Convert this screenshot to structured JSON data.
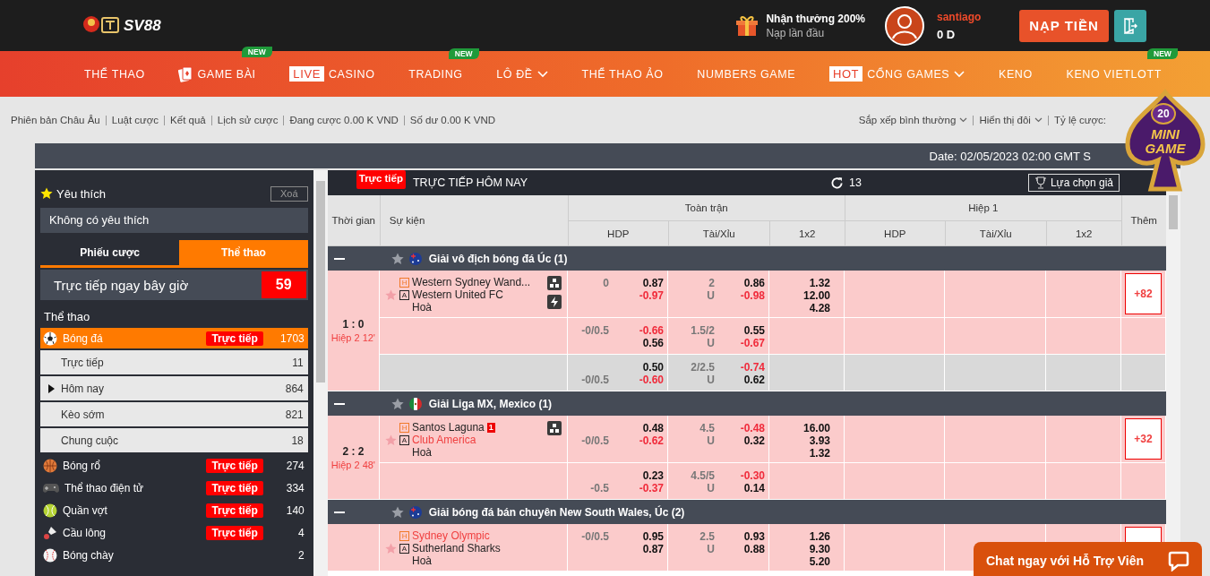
{
  "logo": {
    "text": "SV88"
  },
  "header": {
    "promo": {
      "title": "Nhận thưởng 200%",
      "subtitle": "Nạp lần đầu"
    },
    "user": {
      "name": "santiago",
      "balance": "0 D"
    },
    "deposit_button": "NẠP TIỀN"
  },
  "nav": [
    {
      "label": "THỂ THAO",
      "dropdown": false
    },
    {
      "label": "GAME BÀI",
      "kind": "cards",
      "badge": "NEW",
      "dropdown": false
    },
    {
      "tag": "LIVE",
      "label": "CASINO",
      "dropdown": false
    },
    {
      "label": "TRADING",
      "badge": "NEW",
      "dropdown": false
    },
    {
      "label": "LÔ ĐỀ",
      "dropdown": true
    },
    {
      "label": "THỂ THAO ẢO",
      "dropdown": false
    },
    {
      "label": "NUMBERS GAME",
      "dropdown": false
    },
    {
      "tag": "HOT",
      "label": "CỔNG GAMES",
      "dropdown": true
    },
    {
      "label": "KENO",
      "dropdown": false
    },
    {
      "label": "KENO VIETLOTT",
      "badge": "NEW",
      "dropdown": false
    }
  ],
  "sub_links": [
    "Phiên bản Châu Âu",
    "Luật cược",
    "Kết quả",
    "Lịch sử cược",
    "Đang cược 0.00 K VND",
    "Số dư 0.00 K VND"
  ],
  "view_menus": [
    {
      "label": "Sắp xếp bình thường",
      "dropdown": true
    },
    {
      "label": "Hiển thị đôi",
      "dropdown": true
    },
    {
      "label": "Tỷ lệ cược:",
      "dropdown": false
    }
  ],
  "date": "Date: 02/05/2023 02:00 GMT S",
  "mini_game": {
    "count": "20",
    "line_1": "MINI",
    "line_2": "GAME"
  },
  "sidebar": {
    "favorites": {
      "title": "Yêu thích",
      "clear": "Xoá",
      "empty": "Không có yêu thích"
    },
    "tabs": [
      {
        "label": "Phiếu cược",
        "selected": false
      },
      {
        "label": "Thể thao",
        "selected": true
      }
    ],
    "live_now": {
      "label": "Trực tiếp ngay bây giờ",
      "count": "59"
    },
    "sports_title": "Thể thao",
    "sports": [
      {
        "kind": "soccer",
        "name": "Bóng đá",
        "live": "Trực tiếp",
        "count": "1703",
        "selected": true,
        "children": [
          {
            "name": "Trực tiếp",
            "count": "11",
            "selected": false
          },
          {
            "name": "Hôm nay",
            "count": "864",
            "selected": true
          },
          {
            "name": "Kèo sớm",
            "count": "821",
            "selected": false
          },
          {
            "name": "Chung cuộc",
            "count": "18",
            "selected": false
          }
        ]
      },
      {
        "kind": "basketball",
        "name": "Bóng rổ",
        "live": "Trực tiếp",
        "count": "274",
        "selected": false
      },
      {
        "kind": "esports",
        "name": "Thể thao điện tử",
        "live": "Trực tiếp",
        "count": "334",
        "selected": false
      },
      {
        "kind": "tennis",
        "name": "Quần vợt",
        "live": "Trực tiếp",
        "count": "140",
        "selected": false
      },
      {
        "kind": "badminton",
        "name": "Cầu lông",
        "live": "Trực tiếp",
        "count": "4",
        "selected": false
      },
      {
        "kind": "baseball",
        "name": "Bóng chày",
        "count": "2",
        "selected": false
      }
    ]
  },
  "board": {
    "live_badge": "Trực tiếp",
    "title": "TRỰC TIẾP HÔM NAY",
    "refresh_count": "13",
    "league_filter": "Lựa chọn giả",
    "columns": {
      "time": "Thời gian",
      "event": "Sự kiện",
      "full_time": "Toàn trận",
      "first_half": "Hiệp 1",
      "more": "Thêm",
      "sub": [
        "HDP",
        "Tài/Xỉu",
        "1x2",
        "HDP",
        "Tài/Xỉu",
        "1x2"
      ]
    },
    "leagues": [
      {
        "name": "Giải vô địch bóng đá Úc (1)",
        "kind": "australia",
        "expanded": true,
        "favorite": false,
        "matches": [
          {
            "score": "1 : 0",
            "period": "Hiệp 2 12'",
            "favorite": false,
            "home": {
              "mark": "H",
              "name": "Western Sydney Wand...",
              "highlight": false
            },
            "away": {
              "mark": "A",
              "name": "Western United FC",
              "highlight": false
            },
            "draw": "Hoà",
            "tools": [
              {
                "kind": "stats"
              },
              {
                "kind": "flash"
              }
            ],
            "more": "+82",
            "lines": [
              {
                "alternate": false,
                "hdp": {
                  "home_line": "0",
                  "odds": [
                    {
                      "value": "0.87",
                      "negative": false
                    },
                    {
                      "value": "-0.97",
                      "negative": true
                    }
                  ]
                },
                "ou": {
                  "line": "2",
                  "under": "U",
                  "odds": [
                    {
                      "value": "0.86",
                      "negative": false
                    },
                    {
                      "value": "-0.98",
                      "negative": true
                    }
                  ]
                },
                "x12": [
                  "1.32",
                  "12.00",
                  "4.28"
                ]
              },
              {
                "alternate": false,
                "hdp": {
                  "home_line": "-0/0.5",
                  "odds": [
                    {
                      "value": "-0.66",
                      "negative": true
                    },
                    {
                      "value": "0.56",
                      "negative": false
                    }
                  ]
                },
                "ou": {
                  "line": "1.5/2",
                  "under": "U",
                  "odds": [
                    {
                      "value": "0.55",
                      "negative": false
                    },
                    {
                      "value": "-0.67",
                      "negative": true
                    }
                  ]
                }
              },
              {
                "alternate": true,
                "hdp": {
                  "away_line": "-0/0.5",
                  "odds": [
                    {
                      "value": "0.50",
                      "negative": false
                    },
                    {
                      "value": "-0.60",
                      "negative": true
                    }
                  ]
                },
                "ou": {
                  "line": "2/2.5",
                  "under": "U",
                  "odds": [
                    {
                      "value": "-0.74",
                      "negative": true
                    },
                    {
                      "value": "0.62",
                      "negative": false
                    }
                  ]
                }
              }
            ]
          }
        ]
      },
      {
        "name": "Giải Liga MX, Mexico (1)",
        "kind": "mexico",
        "expanded": true,
        "favorite": false,
        "matches": [
          {
            "score": "2 : 2",
            "period": "Hiệp 2 48'",
            "favorite": false,
            "home": {
              "mark": "H",
              "name": "Santos Laguna",
              "highlight": false,
              "red_cards": "1"
            },
            "away": {
              "mark": "A",
              "name": "Club America",
              "highlight": true
            },
            "draw": "Hoà",
            "tools": [
              {
                "kind": "stats"
              }
            ],
            "more": "+32",
            "lines": [
              {
                "alternate": false,
                "hdp": {
                  "away_line": "-0/0.5",
                  "odds": [
                    {
                      "value": "0.48",
                      "negative": false
                    },
                    {
                      "value": "-0.62",
                      "negative": true
                    }
                  ]
                },
                "ou": {
                  "line": "4.5",
                  "under": "U",
                  "odds": [
                    {
                      "value": "-0.48",
                      "negative": true
                    },
                    {
                      "value": "0.32",
                      "negative": false
                    }
                  ]
                },
                "x12": [
                  "16.00",
                  "3.93",
                  "1.32"
                ]
              },
              {
                "alternate": false,
                "hdp": {
                  "away_line": "-0.5",
                  "odds": [
                    {
                      "value": "0.23",
                      "negative": false
                    },
                    {
                      "value": "-0.37",
                      "negative": true
                    }
                  ]
                },
                "ou": {
                  "line": "4.5/5",
                  "under": "U",
                  "odds": [
                    {
                      "value": "-0.30",
                      "negative": true
                    },
                    {
                      "value": "0.14",
                      "negative": false
                    }
                  ]
                }
              }
            ]
          }
        ]
      },
      {
        "name": "Giải bóng đá bán chuyên New South Wales, Úc (2)",
        "kind": "australia",
        "expanded": true,
        "favorite": false,
        "matches": [
          {
            "favorite": false,
            "home": {
              "mark": "H",
              "name": "Sydney Olympic",
              "highlight": true
            },
            "away": {
              "mark": "A",
              "name": "Sutherland Sharks",
              "highlight": false
            },
            "draw": "Hoà",
            "lines": [
              {
                "alternate": false,
                "hdp": {
                  "home_line": "-0/0.5",
                  "odds": [
                    {
                      "value": "0.95",
                      "negative": false
                    },
                    {
                      "value": "0.87",
                      "negative": false
                    }
                  ]
                },
                "ou": {
                  "line": "2.5",
                  "under": "U",
                  "odds": [
                    {
                      "value": "0.93",
                      "negative": false
                    },
                    {
                      "value": "0.88",
                      "negative": false
                    }
                  ]
                },
                "x12": [
                  "1.26",
                  "9.30",
                  "5.20"
                ]
              }
            ]
          }
        ]
      }
    ]
  },
  "chat": {
    "label": "Chat ngay với Hỗ Trợ Viên"
  }
}
